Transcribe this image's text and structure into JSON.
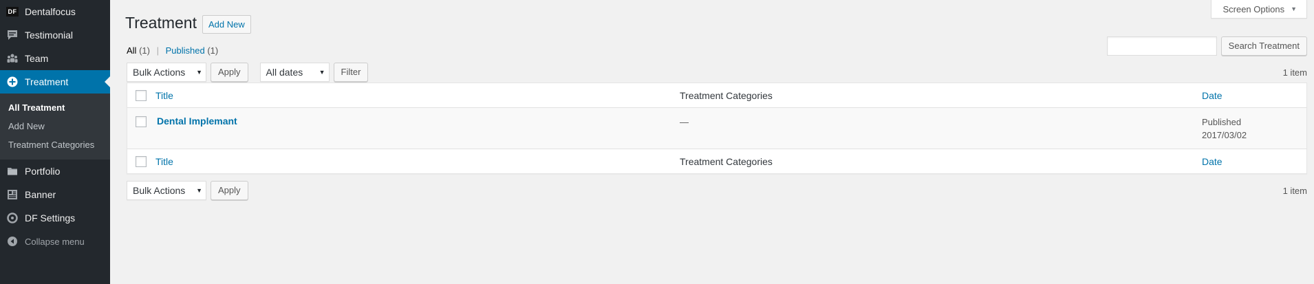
{
  "sidebar": {
    "items": [
      {
        "label": "Dentalfocus",
        "icon": "df-logo-icon"
      },
      {
        "label": "Testimonial",
        "icon": "comment-icon"
      },
      {
        "label": "Team",
        "icon": "groups-icon"
      },
      {
        "label": "Treatment",
        "icon": "plus-circle-icon",
        "current": true
      },
      {
        "label": "Portfolio",
        "icon": "portfolio-icon"
      },
      {
        "label": "Banner",
        "icon": "banner-icon"
      },
      {
        "label": "DF Settings",
        "icon": "settings-icon"
      }
    ],
    "df_badge": "DF",
    "submenu": [
      "All Treatment",
      "Add New",
      "Treatment Categories"
    ],
    "collapse_label": "Collapse menu"
  },
  "header": {
    "screen_options": "Screen Options",
    "title": "Treatment",
    "add_new": "Add New"
  },
  "views": {
    "all_label": "All",
    "all_count": "(1)",
    "separator": "|",
    "published_label": "Published",
    "published_count": "(1)"
  },
  "search": {
    "placeholder": "",
    "button": "Search Treatment"
  },
  "tablenav": {
    "bulk_actions": "Bulk Actions",
    "apply": "Apply",
    "dates": "All dates",
    "filter": "Filter",
    "items_count": "1 item"
  },
  "table": {
    "columns": [
      "Title",
      "Treatment Categories",
      "Date"
    ],
    "rows": [
      {
        "title": "Dental Implemant",
        "categories": "—",
        "status": "Published",
        "date": "2017/03/02"
      }
    ]
  },
  "colors": {
    "sidebar_bg": "#23282d",
    "accent": "#0073aa",
    "page_bg": "#f1f1f1"
  }
}
